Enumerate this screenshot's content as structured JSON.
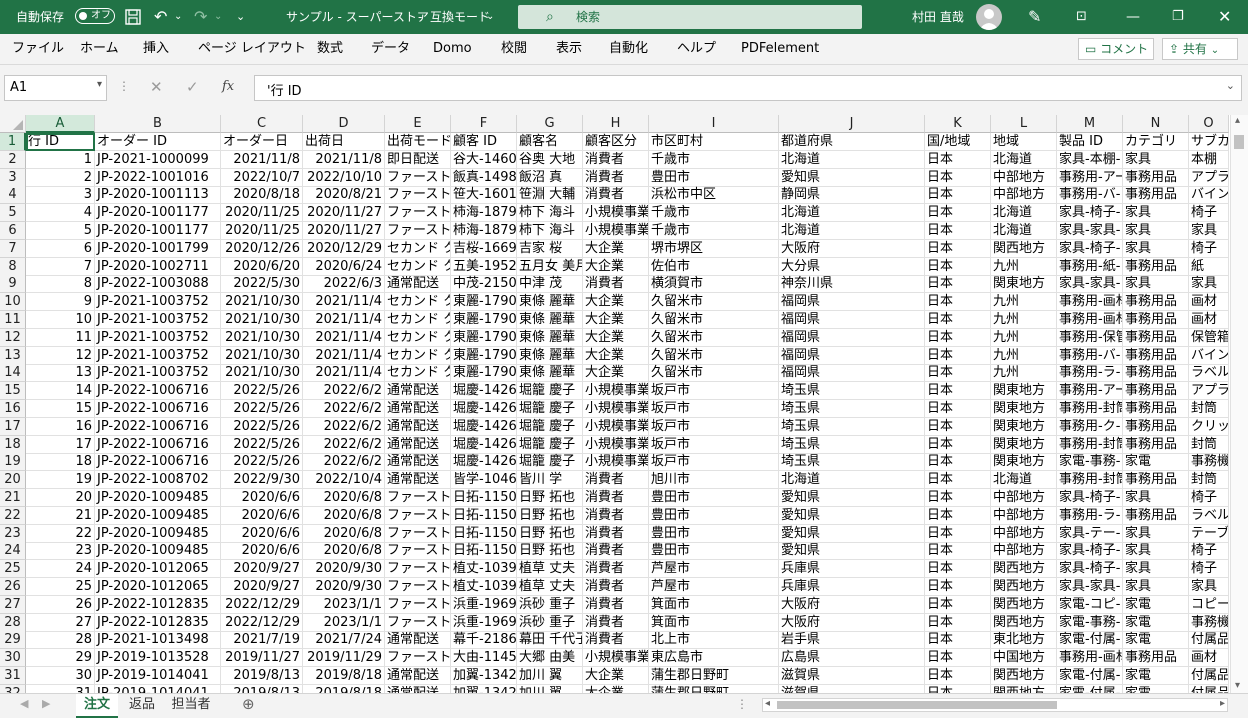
{
  "titlebar": {
    "autosave_label": "自動保存",
    "autosave_state": "オフ",
    "doc_title": "サンプル - スーパーストア",
    "mode_label": "互換モード",
    "search_placeholder": "検索",
    "user_name": "村田 直哉"
  },
  "ribbon": {
    "tabs": [
      "ファイル",
      "ホーム",
      "挿入",
      "ページ レイアウト",
      "数式",
      "データ",
      "Domo",
      "校閲",
      "表示",
      "自動化",
      "ヘルプ",
      "PDFelement"
    ],
    "comment_label": "コメント",
    "share_label": "共有"
  },
  "formula_bar": {
    "name_box": "A1",
    "fx_label": "fx",
    "content": "'行 ID"
  },
  "sheet": {
    "columns": [
      "A",
      "B",
      "C",
      "D",
      "E",
      "F",
      "G",
      "H",
      "I",
      "J",
      "K",
      "L",
      "M",
      "N",
      "O"
    ],
    "row_numbers": [
      "1",
      "2",
      "3",
      "4",
      "5",
      "6",
      "7",
      "8",
      "9",
      "10",
      "11",
      "12",
      "13",
      "14",
      "15",
      "16",
      "17",
      "18",
      "19",
      "20",
      "21",
      "22",
      "23",
      "24",
      "25",
      "26",
      "27",
      "28",
      "29",
      "30",
      "31",
      "32"
    ],
    "rows": [
      [
        "行 ID",
        "オーダー ID",
        "オーダー日",
        "出荷日",
        "出荷モード",
        "顧客 ID",
        "顧客名",
        "顧客区分",
        "市区町村",
        "都道府県",
        "国/地域",
        "地域",
        "製品 ID",
        "カテゴリ",
        "サブカ"
      ],
      [
        "1",
        "JP-2021-1000099",
        "2021/11/8",
        "2021/11/8",
        "即日配送",
        "谷大-14605",
        "谷奥 大地",
        "消費者",
        "千歳市",
        "北海道",
        "日本",
        "北海道",
        "家具-本棚-",
        "家具",
        "本棚"
      ],
      [
        "2",
        "JP-2022-1001016",
        "2022/10/7",
        "2022/10/10",
        "ファースト",
        "飯真-14980",
        "飯沼 真",
        "消費者",
        "豊田市",
        "愛知県",
        "日本",
        "中部地方",
        "事務用-アー",
        "事務用品",
        "アプラ"
      ],
      [
        "3",
        "JP-2020-1001113",
        "2020/8/18",
        "2020/8/21",
        "ファースト",
        "笹大-16015",
        "笹淵 大輔",
        "消費者",
        "浜松市中区",
        "静岡県",
        "日本",
        "中部地方",
        "事務用-バ-",
        "事務用品",
        "バイン"
      ],
      [
        "4",
        "JP-2020-1001177",
        "2020/11/25",
        "2020/11/27",
        "ファースト",
        "柿海-18790",
        "柿下 海斗",
        "小規模事業",
        "千歳市",
        "北海道",
        "日本",
        "北海道",
        "家具-椅子-",
        "家具",
        "椅子"
      ],
      [
        "5",
        "JP-2020-1001177",
        "2020/11/25",
        "2020/11/27",
        "ファースト",
        "柿海-18790",
        "柿下 海斗",
        "小規模事業",
        "千歳市",
        "北海道",
        "日本",
        "北海道",
        "家具-家具-",
        "家具",
        "家具"
      ],
      [
        "6",
        "JP-2020-1001799",
        "2020/12/26",
        "2020/12/29",
        "セカンド ク",
        "吉桜-16690",
        "吉家 桜",
        "大企業",
        "堺市堺区",
        "大阪府",
        "日本",
        "関西地方",
        "家具-椅子-",
        "家具",
        "椅子"
      ],
      [
        "7",
        "JP-2020-1002711",
        "2020/6/20",
        "2020/6/24",
        "セカンド ク",
        "五美-19525",
        "五月女 美月",
        "大企業",
        "佐伯市",
        "大分県",
        "日本",
        "九州",
        "事務用-紙-",
        "事務用品",
        "紙"
      ],
      [
        "8",
        "JP-2022-1003088",
        "2022/5/30",
        "2022/6/3",
        "通常配送",
        "中茂-21505",
        "中津 茂",
        "消費者",
        "横須賀市",
        "神奈川県",
        "日本",
        "関東地方",
        "家具-家具-",
        "家具",
        "家具"
      ],
      [
        "9",
        "JP-2021-1003752",
        "2021/10/30",
        "2021/11/4",
        "セカンド ク",
        "東麗-17905",
        "東條 麗華",
        "大企業",
        "久留米市",
        "福岡県",
        "日本",
        "九州",
        "事務用-画材",
        "事務用品",
        "画材"
      ],
      [
        "10",
        "JP-2021-1003752",
        "2021/10/30",
        "2021/11/4",
        "セカンド ク",
        "東麗-17905",
        "東條 麗華",
        "大企業",
        "久留米市",
        "福岡県",
        "日本",
        "九州",
        "事務用-画材",
        "事務用品",
        "画材"
      ],
      [
        "11",
        "JP-2021-1003752",
        "2021/10/30",
        "2021/11/4",
        "セカンド ク",
        "東麗-17905",
        "東條 麗華",
        "大企業",
        "久留米市",
        "福岡県",
        "日本",
        "九州",
        "事務用-保管",
        "事務用品",
        "保管箱"
      ],
      [
        "12",
        "JP-2021-1003752",
        "2021/10/30",
        "2021/11/4",
        "セカンド ク",
        "東麗-17905",
        "東條 麗華",
        "大企業",
        "久留米市",
        "福岡県",
        "日本",
        "九州",
        "事務用-バ-",
        "事務用品",
        "バイン"
      ],
      [
        "13",
        "JP-2021-1003752",
        "2021/10/30",
        "2021/11/4",
        "セカンド ク",
        "東麗-17905",
        "東條 麗華",
        "大企業",
        "久留米市",
        "福岡県",
        "日本",
        "九州",
        "事務用-ラ-",
        "事務用品",
        "ラベル"
      ],
      [
        "14",
        "JP-2022-1006716",
        "2022/5/26",
        "2022/6/2",
        "通常配送",
        "堀慶-14260",
        "堀籠 慶子",
        "小規模事業",
        "坂戸市",
        "埼玉県",
        "日本",
        "関東地方",
        "事務用-アー",
        "事務用品",
        "アプラ"
      ],
      [
        "15",
        "JP-2022-1006716",
        "2022/5/26",
        "2022/6/2",
        "通常配送",
        "堀慶-14260",
        "堀籠 慶子",
        "小規模事業",
        "坂戸市",
        "埼玉県",
        "日本",
        "関東地方",
        "事務用-封筒",
        "事務用品",
        "封筒"
      ],
      [
        "16",
        "JP-2022-1006716",
        "2022/5/26",
        "2022/6/2",
        "通常配送",
        "堀慶-14260",
        "堀籠 慶子",
        "小規模事業",
        "坂戸市",
        "埼玉県",
        "日本",
        "関東地方",
        "事務用-ク-",
        "事務用品",
        "クリッ"
      ],
      [
        "17",
        "JP-2022-1006716",
        "2022/5/26",
        "2022/6/2",
        "通常配送",
        "堀慶-14260",
        "堀籠 慶子",
        "小規模事業",
        "坂戸市",
        "埼玉県",
        "日本",
        "関東地方",
        "事務用-封筒",
        "事務用品",
        "封筒"
      ],
      [
        "18",
        "JP-2022-1006716",
        "2022/5/26",
        "2022/6/2",
        "通常配送",
        "堀慶-14260",
        "堀籠 慶子",
        "小規模事業",
        "坂戸市",
        "埼玉県",
        "日本",
        "関東地方",
        "家電-事務-",
        "家電",
        "事務機"
      ],
      [
        "19",
        "JP-2022-1008702",
        "2022/9/30",
        "2022/10/4",
        "通常配送",
        "皆学-10465",
        "皆川 学",
        "消費者",
        "旭川市",
        "北海道",
        "日本",
        "北海道",
        "事務用-封筒",
        "事務用品",
        "封筒"
      ],
      [
        "20",
        "JP-2020-1009485",
        "2020/6/6",
        "2020/6/8",
        "ファースト",
        "日拓-11500",
        "日野 拓也",
        "消費者",
        "豊田市",
        "愛知県",
        "日本",
        "中部地方",
        "家具-椅子-",
        "家具",
        "椅子"
      ],
      [
        "21",
        "JP-2020-1009485",
        "2020/6/6",
        "2020/6/8",
        "ファースト",
        "日拓-11500",
        "日野 拓也",
        "消費者",
        "豊田市",
        "愛知県",
        "日本",
        "中部地方",
        "事務用-ラ-",
        "事務用品",
        "ラベル"
      ],
      [
        "22",
        "JP-2020-1009485",
        "2020/6/6",
        "2020/6/8",
        "ファースト",
        "日拓-11500",
        "日野 拓也",
        "消費者",
        "豊田市",
        "愛知県",
        "日本",
        "中部地方",
        "家具-テー-",
        "家具",
        "テーブ"
      ],
      [
        "23",
        "JP-2020-1009485",
        "2020/6/6",
        "2020/6/8",
        "ファースト",
        "日拓-11500",
        "日野 拓也",
        "消費者",
        "豊田市",
        "愛知県",
        "日本",
        "中部地方",
        "家具-椅子-",
        "家具",
        "椅子"
      ],
      [
        "24",
        "JP-2020-1012065",
        "2020/9/27",
        "2020/9/30",
        "ファースト",
        "植丈-10390",
        "植草 丈夫",
        "消費者",
        "芦屋市",
        "兵庫県",
        "日本",
        "関西地方",
        "家具-椅子-",
        "家具",
        "椅子"
      ],
      [
        "25",
        "JP-2020-1012065",
        "2020/9/27",
        "2020/9/30",
        "ファースト",
        "植丈-10390",
        "植草 丈夫",
        "消費者",
        "芦屋市",
        "兵庫県",
        "日本",
        "関西地方",
        "家具-家具-",
        "家具",
        "家具"
      ],
      [
        "26",
        "JP-2022-1012835",
        "2022/12/29",
        "2023/1/1",
        "ファースト",
        "浜重-19690",
        "浜砂 重子",
        "消費者",
        "箕面市",
        "大阪府",
        "日本",
        "関西地方",
        "家電-コピ-",
        "家電",
        "コピー"
      ],
      [
        "27",
        "JP-2022-1012835",
        "2022/12/29",
        "2023/1/1",
        "ファースト",
        "浜重-19690",
        "浜砂 重子",
        "消費者",
        "箕面市",
        "大阪府",
        "日本",
        "関西地方",
        "家電-事務-",
        "家電",
        "事務機"
      ],
      [
        "28",
        "JP-2021-1013498",
        "2021/7/19",
        "2021/7/24",
        "通常配送",
        "幕千-21865",
        "幕田 千代子",
        "消費者",
        "北上市",
        "岩手県",
        "日本",
        "東北地方",
        "家電-付属-",
        "家電",
        "付属品"
      ],
      [
        "29",
        "JP-2019-1013528",
        "2019/11/27",
        "2019/11/29",
        "ファースト",
        "大由-11455",
        "大郷 由美",
        "小規模事業",
        "東広島市",
        "広島県",
        "日本",
        "中国地方",
        "事務用-画材",
        "事務用品",
        "画材"
      ],
      [
        "30",
        "JP-2019-1014041",
        "2019/8/13",
        "2019/8/18",
        "通常配送",
        "加翼-13420",
        "加川 翼",
        "大企業",
        "蒲生郡日野町",
        "滋賀県",
        "日本",
        "関西地方",
        "家電-付属-",
        "家電",
        "付属品"
      ],
      [
        "31",
        "JP-2019-1014041",
        "2019/8/13",
        "2019/8/18",
        "通常配送",
        "加翼-13420",
        "加川 翼",
        "大企業",
        "蒲生郡日野町",
        "滋賀県",
        "日本",
        "関西地方",
        "家電-付属-",
        "家電",
        "付属品"
      ]
    ]
  },
  "sheet_tabs": [
    "注文",
    "返品",
    "担当者"
  ],
  "colors": {
    "accent": "#217346",
    "header_bg": "#f3f3f3",
    "selected_header": "#d3e9db"
  }
}
